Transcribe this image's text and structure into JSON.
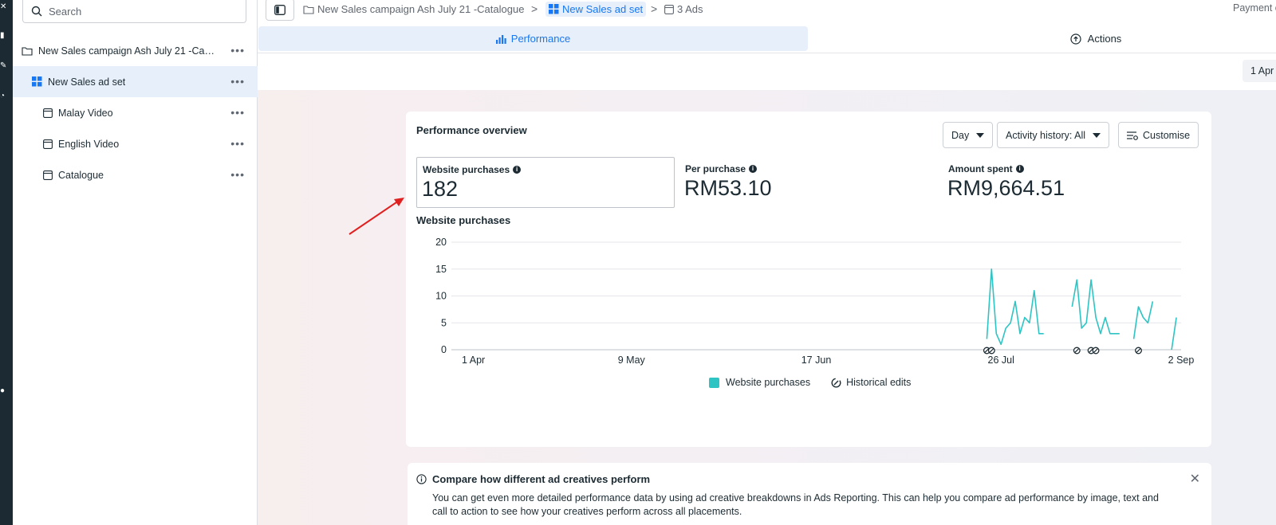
{
  "sidebar": {
    "search_placeholder": "Search",
    "items": [
      {
        "label": "New Sales campaign Ash July 21 -Catal...",
        "type": "campaign"
      },
      {
        "label": "New Sales ad set",
        "type": "adset"
      },
      {
        "label": "Malay Video",
        "type": "ad"
      },
      {
        "label": "English Video",
        "type": "ad"
      },
      {
        "label": "Catalogue",
        "type": "ad"
      }
    ],
    "more": "•••"
  },
  "breadcrumb": {
    "campaign": "New Sales campaign Ash July 21 -Catalogue",
    "adset": "New Sales ad set",
    "ads": "3 Ads",
    "separator": ">"
  },
  "topbar": {
    "payment": "Payment c"
  },
  "tabs": {
    "performance": "Performance",
    "actions": "Actions"
  },
  "datebar": {
    "date": "1 Apr"
  },
  "overview": {
    "title": "Performance overview",
    "controls": {
      "day": "Day",
      "activity": "Activity history: All",
      "customise": "Customise"
    },
    "metrics": [
      {
        "label": "Website purchases",
        "value": "182"
      },
      {
        "label": "Per purchase",
        "value": "RM53.10"
      },
      {
        "label": "Amount spent",
        "value": "RM9,664.51"
      }
    ],
    "chart_title": "Website purchases",
    "legend": {
      "series": "Website purchases",
      "edits": "Historical edits"
    }
  },
  "notice": {
    "title": "Compare how different ad creatives perform",
    "body": "You can get even more detailed performance data by using ad creative breakdowns in Ads Reporting. This can help you compare ad performance by image, text and call to action to see how your creatives perform across all placements.",
    "close": "✕"
  },
  "colors": {
    "accent": "#1877f2",
    "series": "#2ec4c4",
    "arrow": "#e02020"
  },
  "chart_data": {
    "type": "line",
    "title": "Website purchases",
    "xlabel": "",
    "ylabel": "",
    "x_tick_labels": [
      "1 Apr",
      "9 May",
      "17 Jun",
      "26 Jul",
      "2 Sep"
    ],
    "x_tick_dates": [
      "2024-04-01",
      "2024-05-09",
      "2024-06-17",
      "2024-07-26",
      "2024-09-02"
    ],
    "y_ticks": [
      0,
      5,
      10,
      15,
      20
    ],
    "ylim": [
      0,
      20
    ],
    "xlim": [
      "2024-04-01",
      "2024-09-02"
    ],
    "grid": true,
    "legend_position": "bottom",
    "series": [
      {
        "name": "Website purchases",
        "segments": [
          [
            [
              "2024-07-23",
              2
            ],
            [
              "2024-07-24",
              15
            ],
            [
              "2024-07-25",
              3
            ],
            [
              "2024-07-26",
              1
            ],
            [
              "2024-07-27",
              4
            ],
            [
              "2024-07-28",
              5
            ],
            [
              "2024-07-29",
              9
            ],
            [
              "2024-07-30",
              3
            ],
            [
              "2024-07-31",
              6
            ],
            [
              "2024-08-01",
              5
            ],
            [
              "2024-08-02",
              11
            ],
            [
              "2024-08-03",
              3
            ],
            [
              "2024-08-04",
              3
            ]
          ],
          [
            [
              "2024-08-10",
              8
            ],
            [
              "2024-08-11",
              13
            ],
            [
              "2024-08-12",
              4
            ],
            [
              "2024-08-13",
              5
            ],
            [
              "2024-08-14",
              13
            ],
            [
              "2024-08-15",
              6
            ],
            [
              "2024-08-16",
              3
            ],
            [
              "2024-08-17",
              6
            ],
            [
              "2024-08-18",
              3
            ],
            [
              "2024-08-19",
              3
            ],
            [
              "2024-08-20",
              3
            ]
          ],
          [
            [
              "2024-08-23",
              2
            ],
            [
              "2024-08-24",
              8
            ],
            [
              "2024-08-25",
              6
            ],
            [
              "2024-08-26",
              5
            ],
            [
              "2024-08-27",
              9
            ]
          ],
          [
            [
              "2024-08-31",
              0
            ],
            [
              "2024-09-01",
              6
            ]
          ]
        ]
      }
    ],
    "historical_edits": [
      "2024-07-23",
      "2024-07-24",
      "2024-08-11",
      "2024-08-14",
      "2024-08-15",
      "2024-08-24"
    ]
  }
}
